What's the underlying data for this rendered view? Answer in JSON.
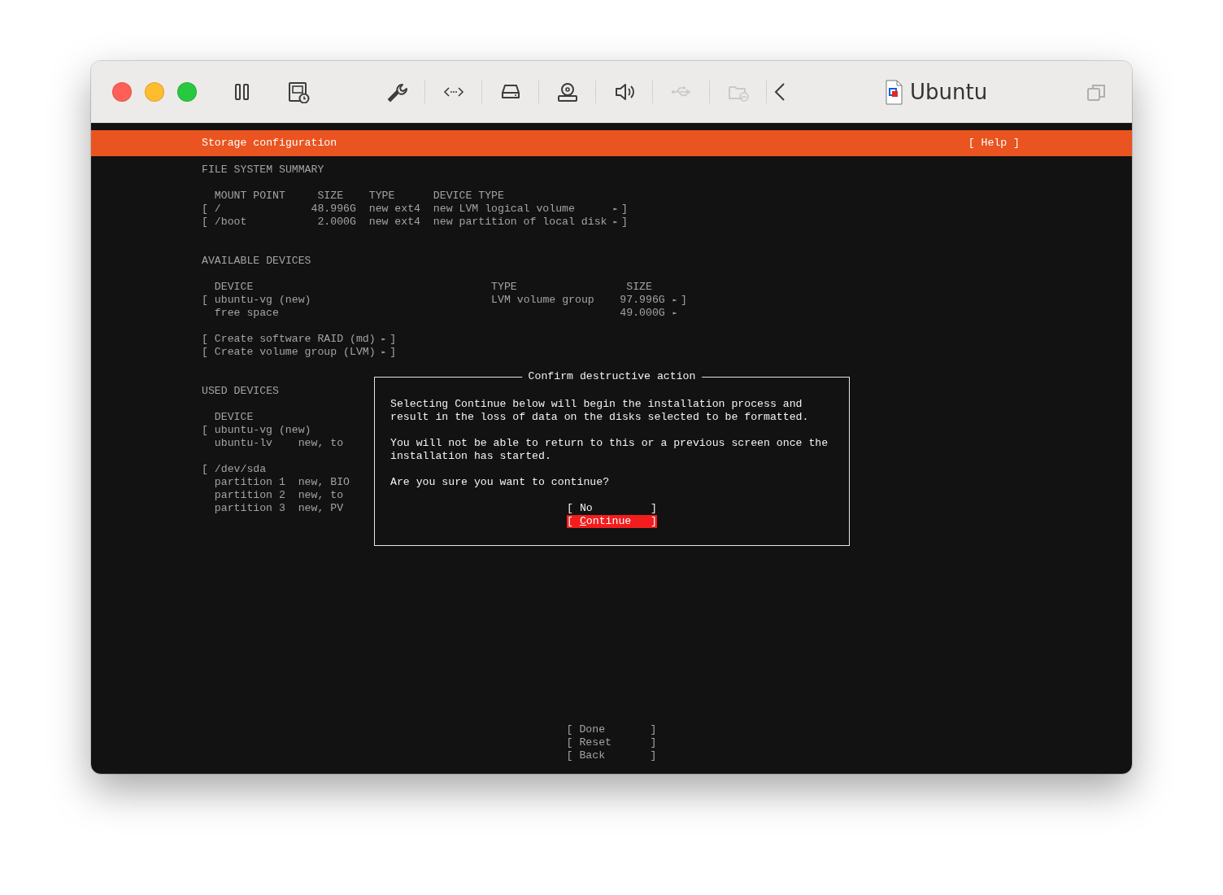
{
  "window": {
    "title": "Ubuntu"
  },
  "toolbar": [
    {
      "kind": "pause",
      "disabled": false
    },
    {
      "kind": "snapshot",
      "disabled": false
    },
    {
      "kind": "wrench",
      "disabled": false
    },
    {
      "kind": "code",
      "disabled": false
    },
    {
      "kind": "drive",
      "disabled": false
    },
    {
      "kind": "disc",
      "disabled": false
    },
    {
      "kind": "speaker",
      "disabled": false
    },
    {
      "kind": "usb",
      "disabled": true
    },
    {
      "kind": "folder",
      "disabled": true
    },
    {
      "kind": "back",
      "disabled": false
    }
  ],
  "header": {
    "title": "Storage configuration",
    "help": "[ Help ]"
  },
  "file_system_summary": {
    "title": "FILE SYSTEM SUMMARY",
    "columns": [
      "MOUNT POINT",
      "SIZE",
      "TYPE",
      "DEVICE TYPE"
    ],
    "rows": [
      {
        "open": "[",
        "mount": "/",
        "size": "48.996G",
        "type": "new ext4",
        "device_type": "new LVM logical volume",
        "arrow": "►",
        "close": "]"
      },
      {
        "open": "[",
        "mount": "/boot",
        "size": "2.000G",
        "type": "new ext4",
        "device_type": "new partition of local disk",
        "arrow": "►",
        "close": "]"
      }
    ]
  },
  "available_devices": {
    "title": "AVAILABLE DEVICES",
    "columns": [
      "DEVICE",
      "TYPE",
      "SIZE"
    ],
    "rows": [
      {
        "open": "[",
        "device": "ubuntu-vg (new)",
        "type": "LVM volume group",
        "size": "97.996G",
        "arrow": "►",
        "close": "]"
      },
      {
        "device": "free space",
        "size": "49.000G",
        "arrow": "►"
      }
    ],
    "actions": [
      {
        "open": "[",
        "label": "Create software RAID (md)",
        "arrow": "►",
        "close": "]"
      },
      {
        "open": "[",
        "label": "Create volume group (LVM)",
        "arrow": "►",
        "close": "]"
      }
    ]
  },
  "used_devices": {
    "title": "USED DEVICES",
    "columns": [
      "DEVICE"
    ],
    "groups": [
      {
        "open": "[",
        "device": "ubuntu-vg (new)",
        "children": [
          {
            "name": "ubuntu-lv",
            "info": "new, to"
          }
        ]
      },
      {
        "open": "[",
        "device": "/dev/sda",
        "children": [
          {
            "name": "partition 1",
            "info": "new, BIO"
          },
          {
            "name": "partition 2",
            "info": "new, to"
          },
          {
            "name": "partition 3",
            "info": "new, PV"
          }
        ]
      }
    ]
  },
  "dialog": {
    "title": "Confirm destructive action",
    "paragraphs": [
      "Selecting Continue below will begin the installation process and result in the loss of data on the disks selected to be formatted.",
      "You will not be able to return to this or a previous screen once the installation has started.",
      "Are you sure you want to continue?"
    ],
    "buttons": [
      {
        "open": "[",
        "label": "No",
        "close": "]",
        "selected": false
      },
      {
        "open": "[",
        "label": "Continue",
        "close": "]",
        "selected": true
      }
    ]
  },
  "buttons": [
    {
      "open": "[",
      "label": "Done",
      "close": "]"
    },
    {
      "open": "[",
      "label": "Reset",
      "close": "]"
    },
    {
      "open": "[",
      "label": "Back",
      "close": "]"
    }
  ]
}
